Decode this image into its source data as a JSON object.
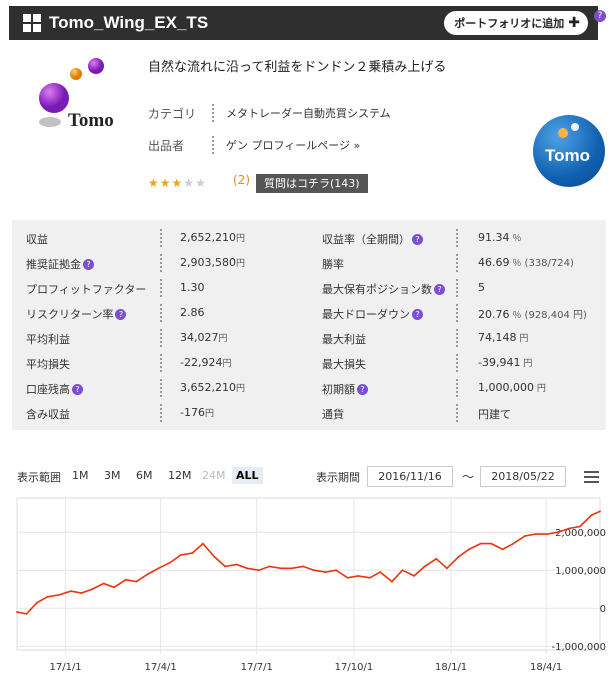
{
  "header": {
    "title": "Tomo_Wing_EX_TS",
    "portfolio_label": "ポートフォリオに追加",
    "portfolio_icon": "plus-icon",
    "help_label": "?"
  },
  "product": {
    "logo_text": "Tomo",
    "tagline": "自然な流れに沿って利益をドンドン２乗積み上げる",
    "category_label": "カテゴリ",
    "category_value": "メタトレーダー自動売買システム",
    "seller_label": "出品者",
    "seller_value": "ゲン プロフィールページ »",
    "rating": 3,
    "rating_max": 5,
    "review_count": "(2)",
    "qa_label": "質問はコチラ(143)",
    "round_logo_text": "Tomo",
    "accent_color": "#7b4fd1",
    "star_color": "#e8a81b"
  },
  "stats": {
    "q_icon": "?",
    "rows": [
      {
        "l_label": "収益",
        "l_value": "2,652,210",
        "l_unit": "円",
        "r_label": "収益率（全期間）",
        "r_value": "91.34",
        "r_unit": "％",
        "r_sub": ""
      },
      {
        "l_label": "推奨証拠金",
        "l_value": "2,903,580",
        "l_unit": "円",
        "r_label": "勝率",
        "r_value": "46.69",
        "r_unit": "％",
        "r_sub": "(338/724)"
      },
      {
        "l_label": "プロフィットファクター",
        "l_value": "1.30",
        "l_unit": "",
        "r_label": "最大保有ポジション数",
        "r_value": "5",
        "r_unit": "",
        "r_sub": ""
      },
      {
        "l_label": "リスクリターン率",
        "l_value": "2.86",
        "l_unit": "",
        "r_label": "最大ドローダウン",
        "r_value": "20.76",
        "r_unit": "％",
        "r_sub": "(928,404 円)"
      },
      {
        "l_label": "平均利益",
        "l_value": "34,027",
        "l_unit": "円",
        "r_label": "最大利益",
        "r_value": "74,148",
        "r_unit": "円",
        "r_sub": ""
      },
      {
        "l_label": "平均損失",
        "l_value": "-22,924",
        "l_unit": "円",
        "r_label": "最大損失",
        "r_value": "-39,941",
        "r_unit": "円",
        "r_sub": ""
      },
      {
        "l_label": "口座残高",
        "l_value": "3,652,210",
        "l_unit": "円",
        "r_label": "初期額",
        "r_value": "1,000,000",
        "r_unit": "円",
        "r_sub": ""
      },
      {
        "l_label": "含み収益",
        "l_value": "-176",
        "l_unit": "円",
        "r_label": "通貨",
        "r_value": "円建て",
        "r_unit": "",
        "r_sub": ""
      }
    ]
  },
  "range": {
    "label": "表示範囲",
    "buttons": [
      "1M",
      "3M",
      "6M",
      "12M",
      "24M",
      "ALL"
    ],
    "disabled": "24M",
    "active": "ALL",
    "period_label": "表示期間",
    "from_date": "2016/11/16",
    "to_date": "2018/05/22",
    "tilde": "〜"
  },
  "chart_data": {
    "type": "line",
    "ylim": [
      -1100000,
      2900000
    ],
    "y_ticks": [
      {
        "value": 2000000,
        "label": "2,000,000"
      },
      {
        "value": 1000000,
        "label": "1,000,000"
      },
      {
        "value": 0,
        "label": "0"
      },
      {
        "value": -1000000,
        "label": "-1,000,000"
      }
    ],
    "x_ticks": [
      "17/1/1",
      "17/4/1",
      "17/7/1",
      "17/10/1",
      "18/1/1",
      "18/4/1"
    ],
    "series": [
      {
        "color": "#e8350f",
        "x": [
          "2016-11-16",
          "2016-11-25",
          "2016-12-05",
          "2016-12-15",
          "2016-12-26",
          "2017-01-06",
          "2017-01-16",
          "2017-01-26",
          "2017-02-06",
          "2017-02-16",
          "2017-02-27",
          "2017-03-09",
          "2017-03-20",
          "2017-03-30",
          "2017-04-10",
          "2017-04-20",
          "2017-05-01",
          "2017-05-11",
          "2017-05-22",
          "2017-06-01",
          "2017-06-12",
          "2017-06-22",
          "2017-07-03",
          "2017-07-13",
          "2017-07-24",
          "2017-08-03",
          "2017-08-14",
          "2017-08-24",
          "2017-09-04",
          "2017-09-14",
          "2017-09-25",
          "2017-10-05",
          "2017-10-16",
          "2017-10-26",
          "2017-11-06",
          "2017-11-16",
          "2017-11-27",
          "2017-12-07",
          "2017-12-18",
          "2017-12-28",
          "2018-01-08",
          "2018-01-18",
          "2018-01-29",
          "2018-02-08",
          "2018-02-19",
          "2018-03-01",
          "2018-03-12",
          "2018-03-22",
          "2018-04-02",
          "2018-04-12",
          "2018-04-23",
          "2018-05-03",
          "2018-05-14",
          "2018-05-22"
        ],
        "values": [
          -100000,
          -150000,
          150000,
          300000,
          350000,
          450000,
          400000,
          500000,
          650000,
          550000,
          750000,
          700000,
          900000,
          1050000,
          1200000,
          1400000,
          1450000,
          1700000,
          1350000,
          1100000,
          1150000,
          1050000,
          1000000,
          1100000,
          1050000,
          1050000,
          1100000,
          1000000,
          950000,
          1000000,
          800000,
          850000,
          800000,
          950000,
          700000,
          1000000,
          850000,
          1100000,
          1300000,
          1050000,
          1350000,
          1550000,
          1700000,
          1700000,
          1550000,
          1700000,
          1900000,
          1950000,
          1950000,
          2000000,
          2100000,
          2150000,
          2450000,
          2550000
        ]
      }
    ]
  }
}
